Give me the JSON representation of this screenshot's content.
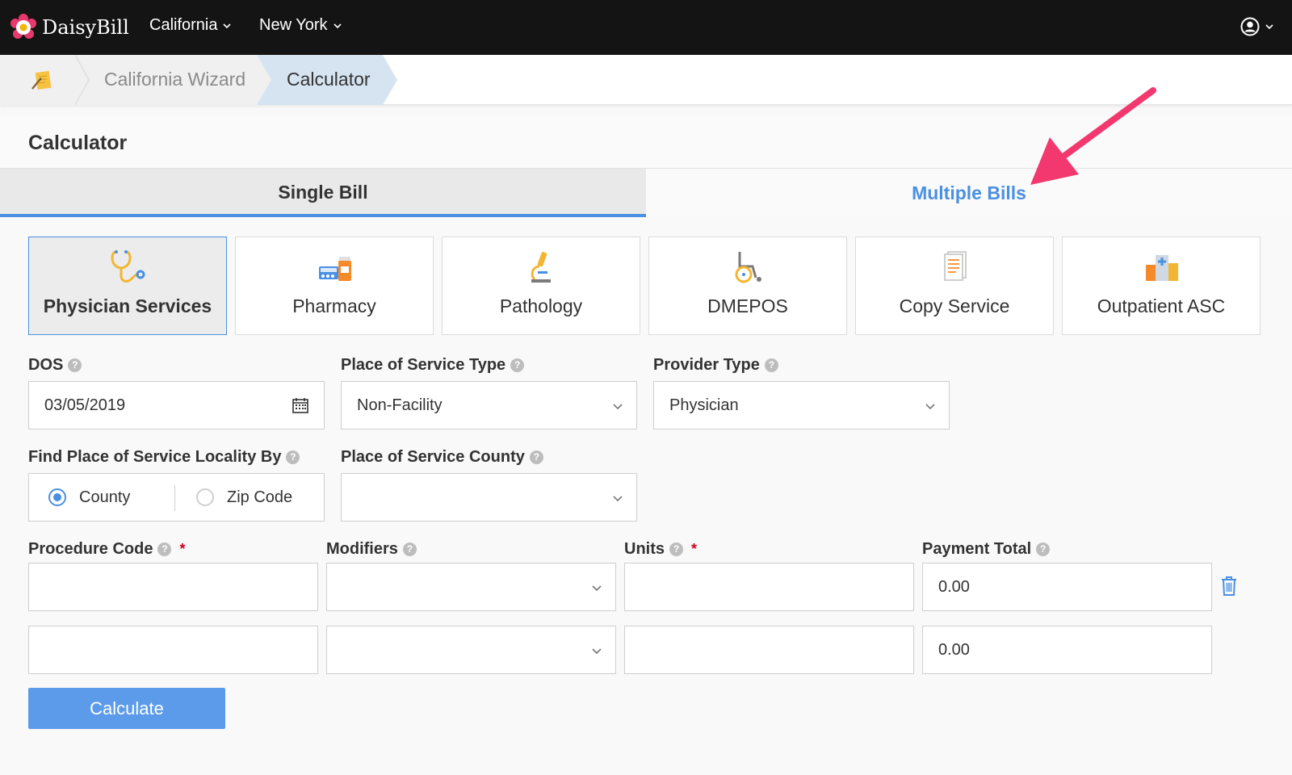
{
  "app": {
    "name": "DaisyBill"
  },
  "topbar": {
    "menus": [
      {
        "label": "California"
      },
      {
        "label": "New York"
      }
    ]
  },
  "breadcrumb": {
    "items": [
      {
        "label": "California Wizard"
      },
      {
        "label": "Calculator"
      }
    ]
  },
  "page": {
    "title": "Calculator"
  },
  "tabs": [
    {
      "label": "Single Bill",
      "active": true
    },
    {
      "label": "Multiple Bills",
      "active": false
    }
  ],
  "service_types": [
    {
      "label": "Physician Services",
      "icon": "stethoscope-icon",
      "active": true
    },
    {
      "label": "Pharmacy",
      "icon": "pharmacy-icon",
      "active": false
    },
    {
      "label": "Pathology",
      "icon": "microscope-icon",
      "active": false
    },
    {
      "label": "DMEPOS",
      "icon": "wheelchair-icon",
      "active": false
    },
    {
      "label": "Copy Service",
      "icon": "document-icon",
      "active": false
    },
    {
      "label": "Outpatient ASC",
      "icon": "hospital-icon",
      "active": false
    }
  ],
  "form": {
    "dos": {
      "label": "DOS",
      "value": "03/05/2019"
    },
    "pos_type": {
      "label": "Place of Service Type",
      "value": "Non-Facility"
    },
    "provider_type": {
      "label": "Provider Type",
      "value": "Physician"
    },
    "locality_by": {
      "label": "Find Place of Service Locality By",
      "options": [
        {
          "label": "County",
          "selected": true
        },
        {
          "label": "Zip Code",
          "selected": false
        }
      ]
    },
    "pos_county": {
      "label": "Place of Service County",
      "value": ""
    },
    "columns": {
      "procedure_code": "Procedure Code",
      "modifiers": "Modifiers",
      "units": "Units",
      "payment_total": "Payment Total",
      "required_mark": "*"
    },
    "rows": [
      {
        "procedure_code": "",
        "modifiers": "",
        "units": "",
        "payment_total": "0.00"
      },
      {
        "procedure_code": "",
        "modifiers": "",
        "units": "",
        "payment_total": "0.00"
      }
    ]
  },
  "actions": {
    "calculate_label": "Calculate"
  },
  "colors": {
    "accent": "#4a90e2",
    "button": "#5b9bea",
    "annotation_arrow": "#f2386e",
    "topbar": "#141414"
  }
}
